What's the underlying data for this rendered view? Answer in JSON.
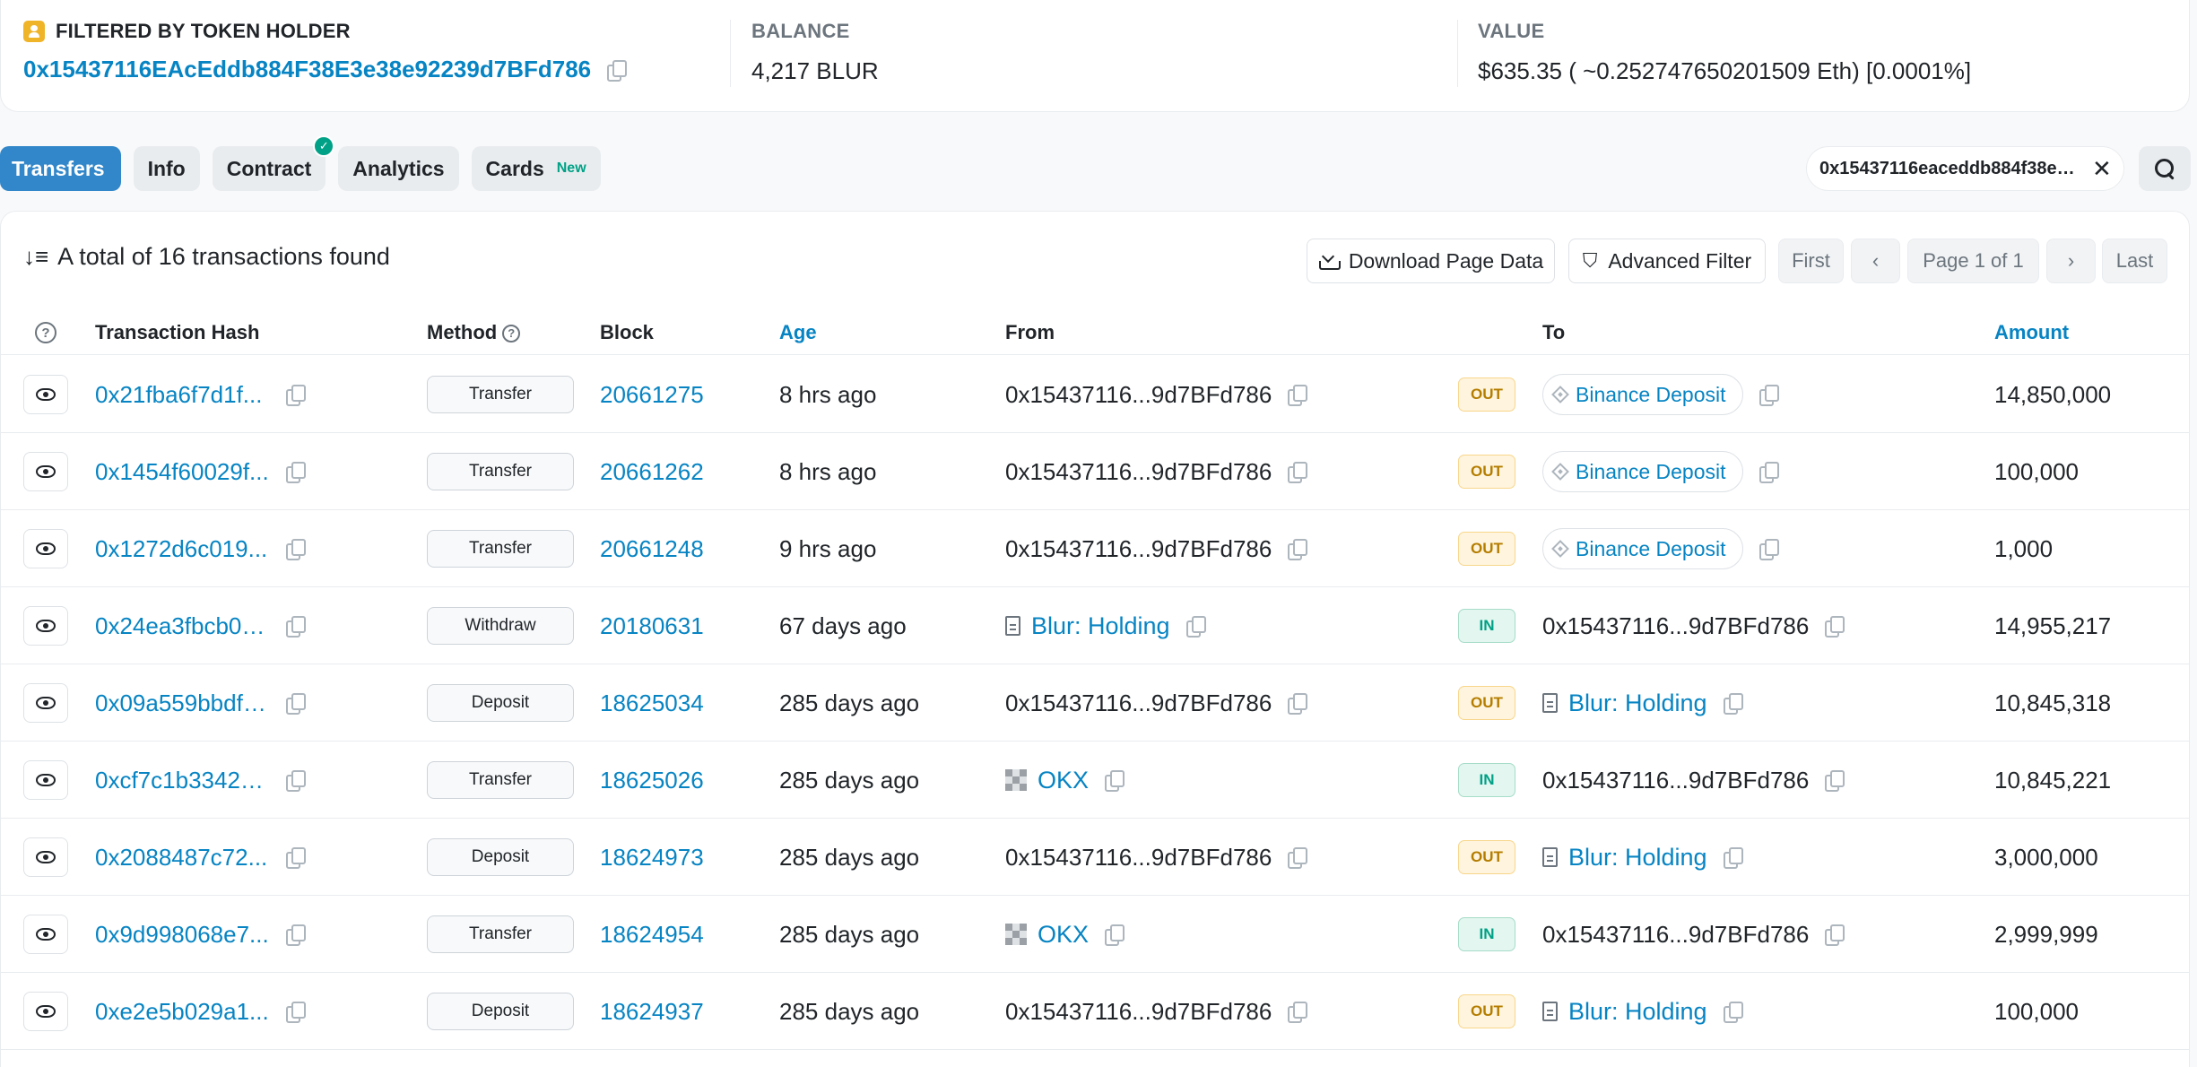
{
  "summary": {
    "holder_title": "FILTERED BY TOKEN HOLDER",
    "holder_address": "0x15437116EAcEddb884F38E3e38e92239d7BFd786",
    "balance_label": "BALANCE",
    "balance_value": "4,217 BLUR",
    "value_label": "VALUE",
    "value_value": "$635.35 ( ~0.252747650201509 Eth) [0.0001%]"
  },
  "tabs": {
    "transfers": "Transfers",
    "info": "Info",
    "contract": "Contract",
    "contract_check": "✓",
    "analytics": "Analytics",
    "cards": "Cards",
    "cards_badge": "New"
  },
  "filter": {
    "address": "0x15437116eaceddb884f38e3...",
    "close": "✕"
  },
  "toolbar": {
    "total_text": "A total of 16 transactions found",
    "sort_icon": "↓≡",
    "download": "Download Page Data",
    "advanced_filter": "Advanced Filter",
    "funnel_icon": "⛉",
    "first": "First",
    "prev": "‹",
    "page_info": "Page 1 of 1",
    "next": "›",
    "last": "Last"
  },
  "table": {
    "help": "?",
    "headers": {
      "hash": "Transaction Hash",
      "method": "Method",
      "block": "Block",
      "age": "Age",
      "from": "From",
      "to": "To",
      "amount": "Amount"
    },
    "rows": [
      {
        "hash": "0x21fba6f7d1f...",
        "method": "Transfer",
        "block": "20661275",
        "age": "8 hrs ago",
        "from": "0x15437116...9d7BFd786",
        "dir": "OUT",
        "to": "Binance Deposit",
        "amount": "14,850,000"
      },
      {
        "hash": "0x1454f60029f...",
        "method": "Transfer",
        "block": "20661262",
        "age": "8 hrs ago",
        "from": "0x15437116...9d7BFd786",
        "dir": "OUT",
        "to": "Binance Deposit",
        "amount": "100,000"
      },
      {
        "hash": "0x1272d6c019...",
        "method": "Transfer",
        "block": "20661248",
        "age": "9 hrs ago",
        "from": "0x15437116...9d7BFd786",
        "dir": "OUT",
        "to": "Binance Deposit",
        "amount": "1,000"
      },
      {
        "hash": "0x24ea3fbcb0a...",
        "method": "Withdraw",
        "block": "20180631",
        "age": "67 days ago",
        "from": "Blur: Holding",
        "dir": "IN",
        "to": "0x15437116...9d7BFd786",
        "amount": "14,955,217"
      },
      {
        "hash": "0x09a559bbdfb...",
        "method": "Deposit",
        "block": "18625034",
        "age": "285 days ago",
        "from": "0x15437116...9d7BFd786",
        "dir": "OUT",
        "to": "Blur: Holding",
        "amount": "10,845,318"
      },
      {
        "hash": "0xcf7c1b33421...",
        "method": "Transfer",
        "block": "18625026",
        "age": "285 days ago",
        "from": "OKX",
        "dir": "IN",
        "to": "0x15437116...9d7BFd786",
        "amount": "10,845,221"
      },
      {
        "hash": "0x2088487c72...",
        "method": "Deposit",
        "block": "18624973",
        "age": "285 days ago",
        "from": "0x15437116...9d7BFd786",
        "dir": "OUT",
        "to": "Blur: Holding",
        "amount": "3,000,000"
      },
      {
        "hash": "0x9d998068e7...",
        "method": "Transfer",
        "block": "18624954",
        "age": "285 days ago",
        "from": "OKX",
        "dir": "IN",
        "to": "0x15437116...9d7BFd786",
        "amount": "2,999,999"
      },
      {
        "hash": "0xe2e5b029a1...",
        "method": "Deposit",
        "block": "18624937",
        "age": "285 days ago",
        "from": "0x15437116...9d7BFd786",
        "dir": "OUT",
        "to": "Blur: Holding",
        "amount": "100,000"
      }
    ]
  }
}
